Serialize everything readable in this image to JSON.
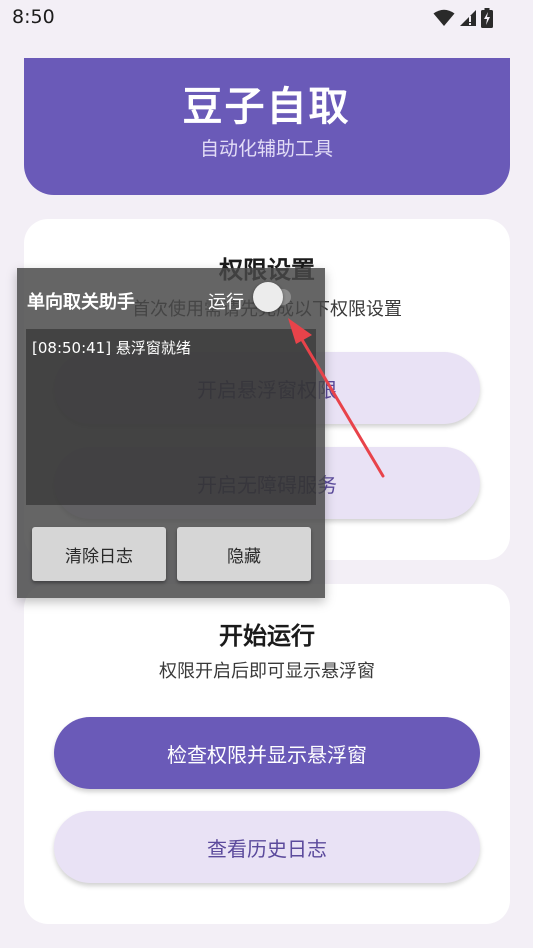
{
  "status_bar": {
    "time": "8:50",
    "icons": [
      "wifi-icon",
      "signal-icon",
      "battery-charging-icon"
    ]
  },
  "header": {
    "title": "豆子自取",
    "subtitle": "自动化辅助工具"
  },
  "permissions_card": {
    "title": "权限设置",
    "subtitle": "首次使用需请先完成以下权限设置",
    "overlay_button_label": "开启悬浮窗权限",
    "accessibility_button_label": "开启无障碍服务"
  },
  "run_card": {
    "title": "开始运行",
    "subtitle": "权限开启后即可显示悬浮窗",
    "check_button_label": "检查权限并显示悬浮窗",
    "history_button_label": "查看历史日志"
  },
  "floating_window": {
    "title": "单向取关助手",
    "run_label": "运行",
    "run_enabled": false,
    "log_lines": [
      "[08:50:41] 悬浮窗就绪"
    ],
    "clear_button_label": "清除日志",
    "hide_button_label": "隐藏"
  },
  "colors": {
    "primary": "#6a5ab8",
    "secondary_button": "#e9e2f5",
    "background": "#f3eff6",
    "annotation_arrow": "#e8434a"
  }
}
